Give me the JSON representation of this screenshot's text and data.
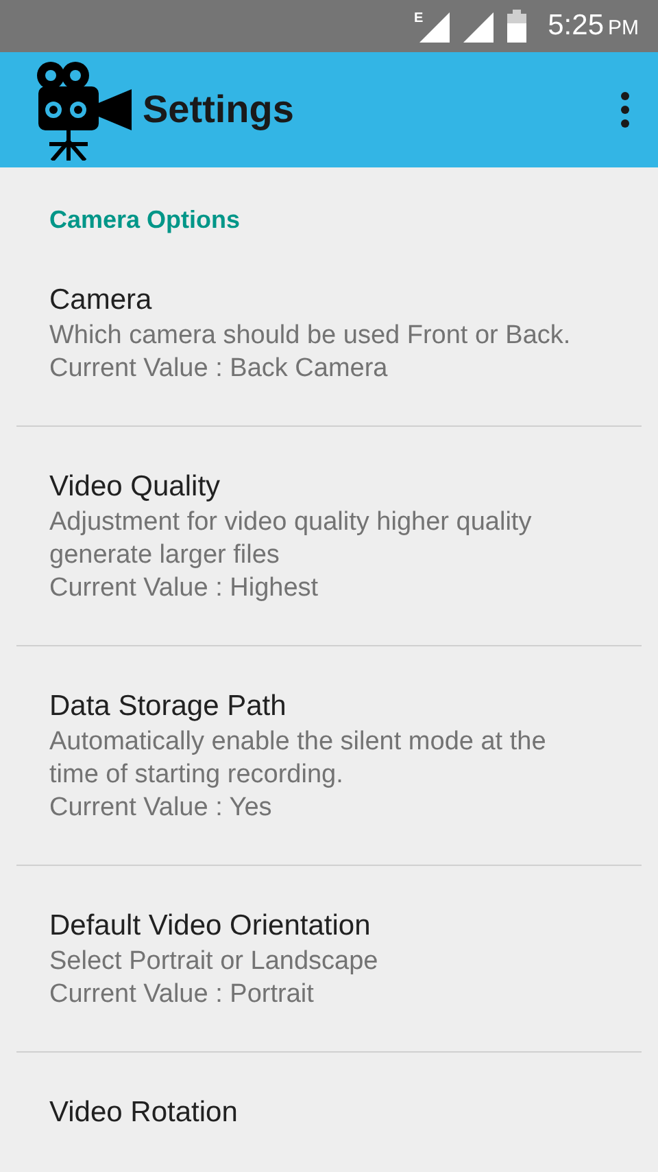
{
  "status_bar": {
    "network_type": "E",
    "time": "5:25",
    "meridiem": "PM"
  },
  "app_bar": {
    "title": "Settings"
  },
  "category": {
    "title": "Camera Options"
  },
  "preferences": [
    {
      "title": "Camera",
      "summary": "Which camera should be used Front or Back.",
      "current_value": "Current Value : Back Camera"
    },
    {
      "title": "Video Quality",
      "summary": "Adjustment for video quality higher quality generate larger files",
      "current_value": "Current Value : Highest"
    },
    {
      "title": "Data Storage Path",
      "summary": "Automatically enable the silent mode at the time of starting recording.",
      "current_value": "Current Value : Yes"
    },
    {
      "title": "Default Video Orientation",
      "summary": "Select Portrait or Landscape",
      "current_value": "Current Value : Portrait"
    },
    {
      "title": "Video Rotation"
    }
  ]
}
